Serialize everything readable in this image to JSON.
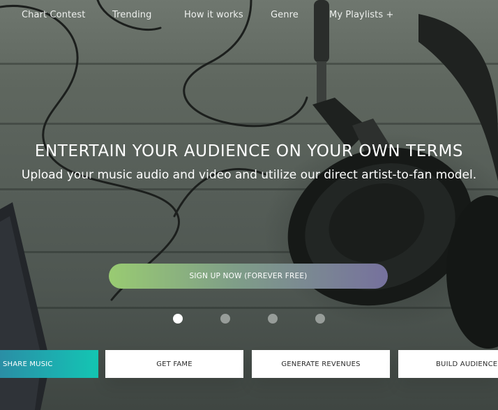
{
  "nav": {
    "items": [
      {
        "label": "Chart Contest"
      },
      {
        "label": "Trending"
      },
      {
        "label": "How it works"
      },
      {
        "label": "Genre"
      },
      {
        "label": "My Playlists +"
      }
    ]
  },
  "hero": {
    "headline": "ENTERTAIN YOUR AUDIENCE ON YOUR OWN TERMS",
    "subline": "Upload your music audio and video and utilize our direct artist-to-fan model.",
    "cta_label": "SIGN UP NOW (FOREVER FREE)",
    "slide_count": 4,
    "active_slide": 1
  },
  "tabs": [
    {
      "label": "SHARE MUSIC",
      "active": true
    },
    {
      "label": "GET FAME",
      "active": false
    },
    {
      "label": "GENERATE REVENUES",
      "active": false
    },
    {
      "label": "BUILD AUDIENCE",
      "active": false
    }
  ],
  "colors": {
    "cta_gradient_start": "#99cb72",
    "cta_gradient_end": "#76719d",
    "active_tab_start": "#2a8ea5",
    "active_tab_end": "#14c6b2"
  },
  "icons": [
    "headphones-image",
    "tablet-image"
  ]
}
